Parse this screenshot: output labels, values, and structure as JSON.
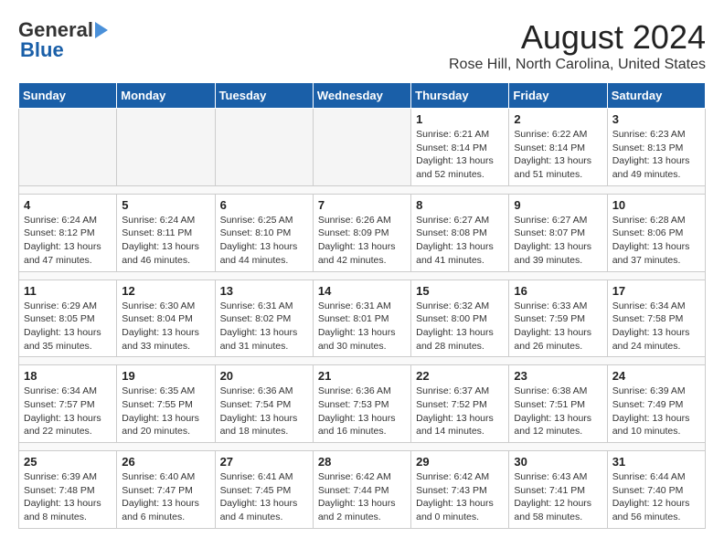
{
  "logo": {
    "line1": "General",
    "line2": "Blue"
  },
  "title": "August 2024",
  "subtitle": "Rose Hill, North Carolina, United States",
  "weekdays": [
    "Sunday",
    "Monday",
    "Tuesday",
    "Wednesday",
    "Thursday",
    "Friday",
    "Saturday"
  ],
  "weeks": [
    [
      {
        "day": "",
        "info": ""
      },
      {
        "day": "",
        "info": ""
      },
      {
        "day": "",
        "info": ""
      },
      {
        "day": "",
        "info": ""
      },
      {
        "day": "1",
        "info": "Sunrise: 6:21 AM\nSunset: 8:14 PM\nDaylight: 13 hours\nand 52 minutes."
      },
      {
        "day": "2",
        "info": "Sunrise: 6:22 AM\nSunset: 8:14 PM\nDaylight: 13 hours\nand 51 minutes."
      },
      {
        "day": "3",
        "info": "Sunrise: 6:23 AM\nSunset: 8:13 PM\nDaylight: 13 hours\nand 49 minutes."
      }
    ],
    [
      {
        "day": "4",
        "info": "Sunrise: 6:24 AM\nSunset: 8:12 PM\nDaylight: 13 hours\nand 47 minutes."
      },
      {
        "day": "5",
        "info": "Sunrise: 6:24 AM\nSunset: 8:11 PM\nDaylight: 13 hours\nand 46 minutes."
      },
      {
        "day": "6",
        "info": "Sunrise: 6:25 AM\nSunset: 8:10 PM\nDaylight: 13 hours\nand 44 minutes."
      },
      {
        "day": "7",
        "info": "Sunrise: 6:26 AM\nSunset: 8:09 PM\nDaylight: 13 hours\nand 42 minutes."
      },
      {
        "day": "8",
        "info": "Sunrise: 6:27 AM\nSunset: 8:08 PM\nDaylight: 13 hours\nand 41 minutes."
      },
      {
        "day": "9",
        "info": "Sunrise: 6:27 AM\nSunset: 8:07 PM\nDaylight: 13 hours\nand 39 minutes."
      },
      {
        "day": "10",
        "info": "Sunrise: 6:28 AM\nSunset: 8:06 PM\nDaylight: 13 hours\nand 37 minutes."
      }
    ],
    [
      {
        "day": "11",
        "info": "Sunrise: 6:29 AM\nSunset: 8:05 PM\nDaylight: 13 hours\nand 35 minutes."
      },
      {
        "day": "12",
        "info": "Sunrise: 6:30 AM\nSunset: 8:04 PM\nDaylight: 13 hours\nand 33 minutes."
      },
      {
        "day": "13",
        "info": "Sunrise: 6:31 AM\nSunset: 8:02 PM\nDaylight: 13 hours\nand 31 minutes."
      },
      {
        "day": "14",
        "info": "Sunrise: 6:31 AM\nSunset: 8:01 PM\nDaylight: 13 hours\nand 30 minutes."
      },
      {
        "day": "15",
        "info": "Sunrise: 6:32 AM\nSunset: 8:00 PM\nDaylight: 13 hours\nand 28 minutes."
      },
      {
        "day": "16",
        "info": "Sunrise: 6:33 AM\nSunset: 7:59 PM\nDaylight: 13 hours\nand 26 minutes."
      },
      {
        "day": "17",
        "info": "Sunrise: 6:34 AM\nSunset: 7:58 PM\nDaylight: 13 hours\nand 24 minutes."
      }
    ],
    [
      {
        "day": "18",
        "info": "Sunrise: 6:34 AM\nSunset: 7:57 PM\nDaylight: 13 hours\nand 22 minutes."
      },
      {
        "day": "19",
        "info": "Sunrise: 6:35 AM\nSunset: 7:55 PM\nDaylight: 13 hours\nand 20 minutes."
      },
      {
        "day": "20",
        "info": "Sunrise: 6:36 AM\nSunset: 7:54 PM\nDaylight: 13 hours\nand 18 minutes."
      },
      {
        "day": "21",
        "info": "Sunrise: 6:36 AM\nSunset: 7:53 PM\nDaylight: 13 hours\nand 16 minutes."
      },
      {
        "day": "22",
        "info": "Sunrise: 6:37 AM\nSunset: 7:52 PM\nDaylight: 13 hours\nand 14 minutes."
      },
      {
        "day": "23",
        "info": "Sunrise: 6:38 AM\nSunset: 7:51 PM\nDaylight: 13 hours\nand 12 minutes."
      },
      {
        "day": "24",
        "info": "Sunrise: 6:39 AM\nSunset: 7:49 PM\nDaylight: 13 hours\nand 10 minutes."
      }
    ],
    [
      {
        "day": "25",
        "info": "Sunrise: 6:39 AM\nSunset: 7:48 PM\nDaylight: 13 hours\nand 8 minutes."
      },
      {
        "day": "26",
        "info": "Sunrise: 6:40 AM\nSunset: 7:47 PM\nDaylight: 13 hours\nand 6 minutes."
      },
      {
        "day": "27",
        "info": "Sunrise: 6:41 AM\nSunset: 7:45 PM\nDaylight: 13 hours\nand 4 minutes."
      },
      {
        "day": "28",
        "info": "Sunrise: 6:42 AM\nSunset: 7:44 PM\nDaylight: 13 hours\nand 2 minutes."
      },
      {
        "day": "29",
        "info": "Sunrise: 6:42 AM\nSunset: 7:43 PM\nDaylight: 13 hours\nand 0 minutes."
      },
      {
        "day": "30",
        "info": "Sunrise: 6:43 AM\nSunset: 7:41 PM\nDaylight: 12 hours\nand 58 minutes."
      },
      {
        "day": "31",
        "info": "Sunrise: 6:44 AM\nSunset: 7:40 PM\nDaylight: 12 hours\nand 56 minutes."
      }
    ]
  ]
}
